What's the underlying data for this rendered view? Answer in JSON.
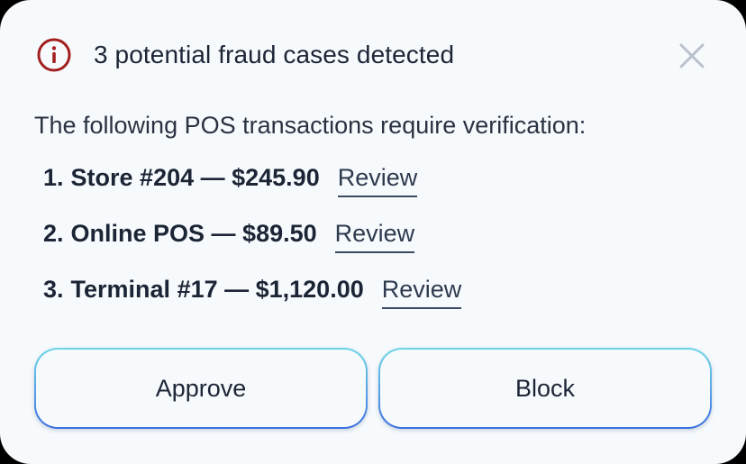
{
  "dialog": {
    "title": "3 potential fraud cases detected",
    "intro": "The following POS transactions require verification:",
    "icon": "info-circle-icon",
    "close_icon": "close-icon",
    "accent_color": "#a31f1f",
    "transactions": [
      {
        "number": "1.",
        "description": "Store #204 — $245.90",
        "action": "Review"
      },
      {
        "number": "2.",
        "description": "Online POS — $89.50",
        "action": "Review"
      },
      {
        "number": "3.",
        "description": "Terminal #17 — $1,120.00",
        "action": "Review"
      }
    ],
    "buttons": {
      "approve": "Approve",
      "block": "Block"
    }
  }
}
